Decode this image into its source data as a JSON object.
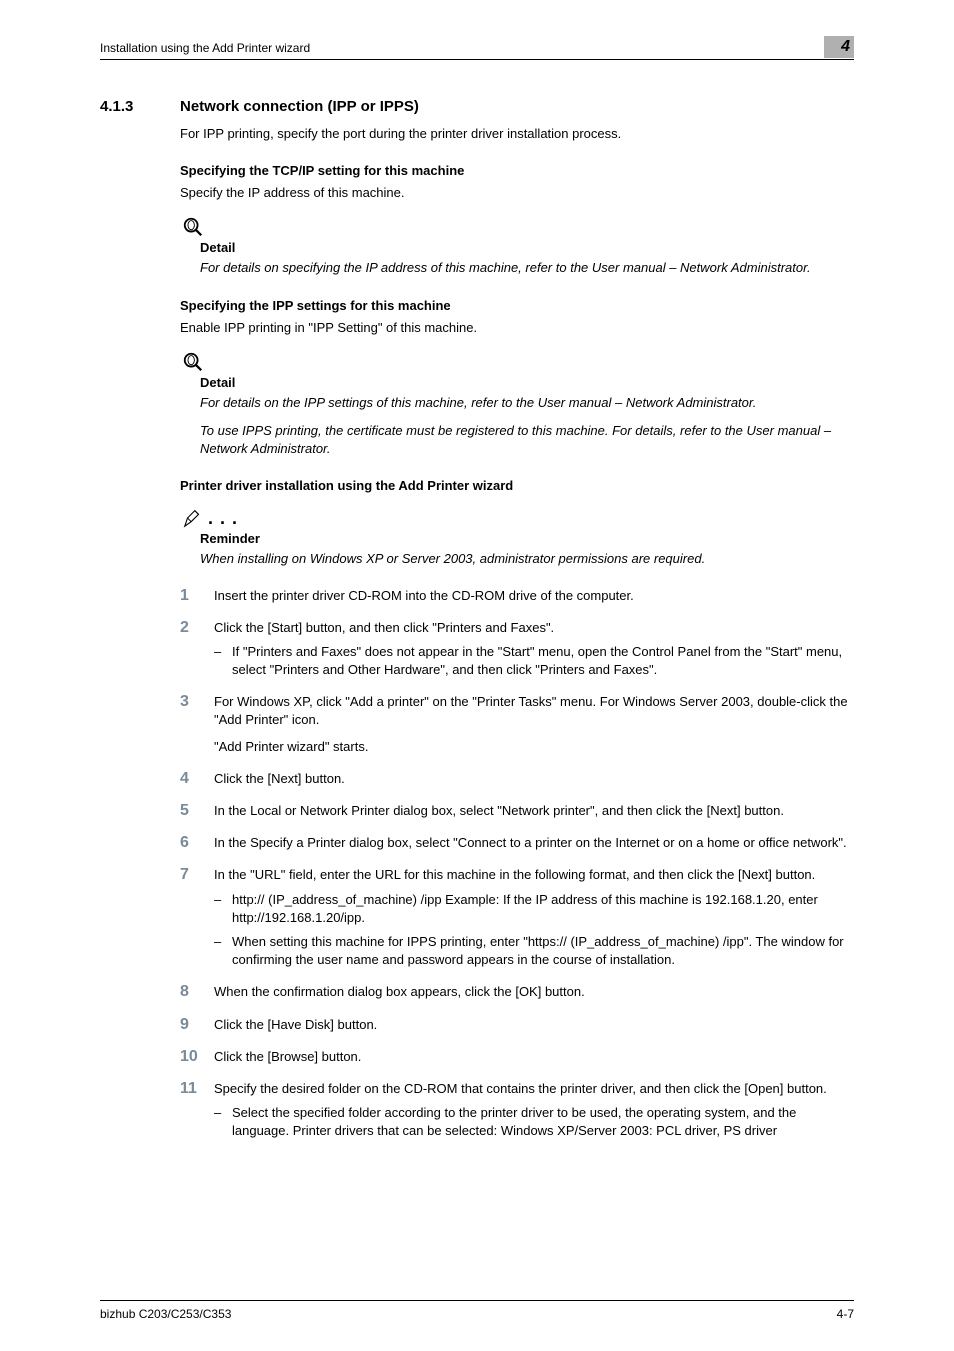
{
  "header": {
    "breadcrumb": "Installation using the Add Printer wizard",
    "chapter_number": "4"
  },
  "section": {
    "number": "4.1.3",
    "title": "Network connection (IPP or IPPS)",
    "intro": "For IPP printing, specify the port during the printer driver installation process."
  },
  "tcpip": {
    "heading": "Specifying the TCP/IP setting for this machine",
    "para": "Specify the IP address of this machine.",
    "detail_label": "Detail",
    "detail_text": "For details on specifying the IP address of this machine, refer to the User manual – Network Administrator."
  },
  "ipp": {
    "heading": "Specifying the IPP settings for this machine",
    "para": "Enable IPP printing in \"IPP Setting\" of this machine.",
    "detail_label": "Detail",
    "detail_text_1": "For details on the IPP settings of this machine, refer to the User manual – Network Administrator.",
    "detail_text_2": "To use IPPS printing, the certificate must be registered to this machine. For details, refer to the User manual – Network Administrator."
  },
  "install": {
    "heading": "Printer driver installation using the Add Printer wizard",
    "reminder_label": "Reminder",
    "reminder_text": "When installing on Windows XP or Server 2003, administrator permissions are required."
  },
  "steps": [
    {
      "n": "1",
      "text": "Insert the printer driver CD-ROM into the CD-ROM drive of the computer."
    },
    {
      "n": "2",
      "text": "Click the [Start] button, and then click \"Printers and Faxes\".",
      "subs": [
        "If \"Printers and Faxes\" does not appear in the \"Start\" menu, open the Control Panel from the \"Start\" menu, select \"Printers and Other Hardware\", and then click \"Printers and Faxes\"."
      ]
    },
    {
      "n": "3",
      "text": "For Windows XP, click \"Add a printer\" on the \"Printer Tasks\" menu. For Windows Server 2003, double-click the \"Add Printer\" icon.",
      "cont": "\"Add Printer wizard\" starts."
    },
    {
      "n": "4",
      "text": "Click the [Next] button."
    },
    {
      "n": "5",
      "text": "In the Local or Network Printer dialog box, select \"Network printer\", and then click the [Next] button."
    },
    {
      "n": "6",
      "text": "In the Specify a Printer dialog box, select \"Connect to a printer on the Internet or on a home or office network\"."
    },
    {
      "n": "7",
      "text": "In the \"URL\" field, enter the URL for this machine in the following format, and then click the [Next] button.",
      "subs": [
        "http:// (IP_address_of_machine) /ipp Example: If the IP address of this machine is 192.168.1.20, enter http://192.168.1.20/ipp.",
        "When setting this machine for IPPS printing, enter \"https:// (IP_address_of_machine) /ipp\". The window for confirming the user name and password appears in the course of installation."
      ]
    },
    {
      "n": "8",
      "text": "When the confirmation dialog box appears, click the [OK] button."
    },
    {
      "n": "9",
      "text": "Click the [Have Disk] button."
    },
    {
      "n": "10",
      "text": "Click the [Browse] button."
    },
    {
      "n": "11",
      "text": "Specify the desired folder on the CD-ROM that contains the printer driver, and then click the [Open] button.",
      "subs": [
        "Select the specified folder according to the printer driver to be used, the operating system, and the language. Printer drivers that can be selected: Windows XP/Server 2003: PCL driver, PS driver"
      ]
    }
  ],
  "footer": {
    "left": "bizhub C203/C253/C353",
    "right": "4-7"
  }
}
